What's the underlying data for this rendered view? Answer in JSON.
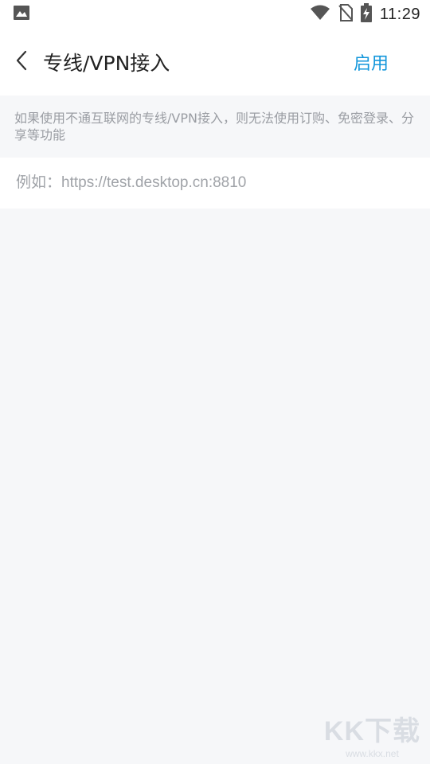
{
  "status_bar": {
    "time": "11:29",
    "icons": [
      "image-icon",
      "wifi-icon",
      "no-sim-icon",
      "battery-charging-icon"
    ]
  },
  "header": {
    "title": "专线/VPN接入",
    "enable_label": "启用",
    "accent_color": "#1296db"
  },
  "notice": {
    "text": "如果使用不通互联网的专线/VPN接入，则无法使用订购、免密登录、分享等功能"
  },
  "url_input": {
    "placeholder": "例如：https://test.desktop.cn:8810",
    "value": ""
  },
  "watermark": {
    "logo": "KK下载",
    "url": "www.kkx.net"
  }
}
